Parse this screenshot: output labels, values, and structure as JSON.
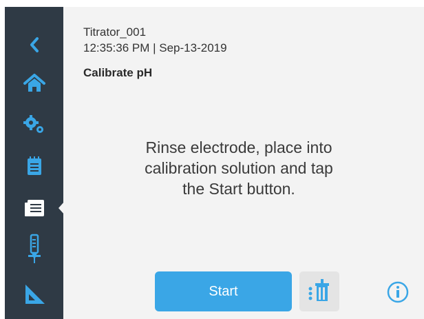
{
  "device": {
    "name": "Titrator_001",
    "datetime": "12:35:36 PM | Sep-13-2019"
  },
  "page": {
    "title": "Calibrate pH",
    "instruction_lines": [
      "Rinse electrode, place into",
      "calibration solution and tap",
      "the Start button."
    ]
  },
  "sidebar": {
    "items": [
      {
        "icon": "back-arrow-icon"
      },
      {
        "icon": "home-icon"
      },
      {
        "icon": "gears-icon"
      },
      {
        "icon": "notepad-icon"
      },
      {
        "icon": "calibration-list-icon",
        "active": true
      },
      {
        "icon": "burette-icon"
      },
      {
        "icon": "ruler-triangle-icon"
      }
    ]
  },
  "actions": {
    "start_label": "Start",
    "setup_icon": "titration-beaker-icon",
    "info_icon": "info-icon"
  },
  "colors": {
    "sidebar_bg": "#2f3a45",
    "icon_blue": "#3aa6e6",
    "start_button": "#3aa6e6",
    "content_bg": "#f3f3f3",
    "active_icon": "#ffffff"
  }
}
